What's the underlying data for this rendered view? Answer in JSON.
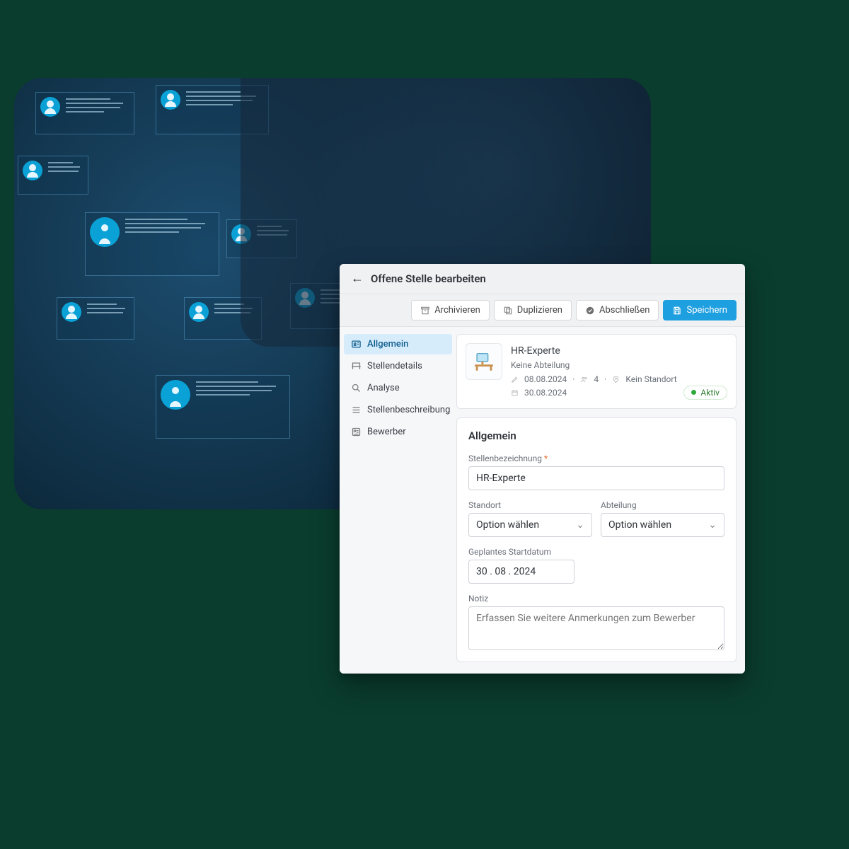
{
  "header": {
    "title": "Offene Stelle bearbeiten"
  },
  "toolbar": {
    "archive": "Archivieren",
    "duplicate": "Duplizieren",
    "close": "Abschließen",
    "save": "Speichern"
  },
  "sidenav": {
    "items": [
      {
        "label": "Allgemein"
      },
      {
        "label": "Stellendetails"
      },
      {
        "label": "Analyse"
      },
      {
        "label": "Stellenbeschreibung"
      },
      {
        "label": "Bewerber"
      }
    ]
  },
  "info": {
    "title": "HR-Experte",
    "department": "Keine Abteilung",
    "created": "08.08.2024",
    "applicants": "4",
    "location": "Kein Standort",
    "planned": "30.08.2024",
    "status": "Aktiv"
  },
  "form": {
    "section_title": "Allgemein",
    "job_title_label": "Stellenbezeichnung",
    "job_title_value": "HR-Experte",
    "location_label": "Standort",
    "location_placeholder": "Option wählen",
    "department_label": "Abteilung",
    "department_placeholder": "Option wählen",
    "start_label": "Geplantes Startdatum",
    "start_value": "30 . 08 . 2024",
    "note_label": "Notiz",
    "note_placeholder": "Erfassen Sie weitere Anmerkungen zum Bewerber"
  }
}
